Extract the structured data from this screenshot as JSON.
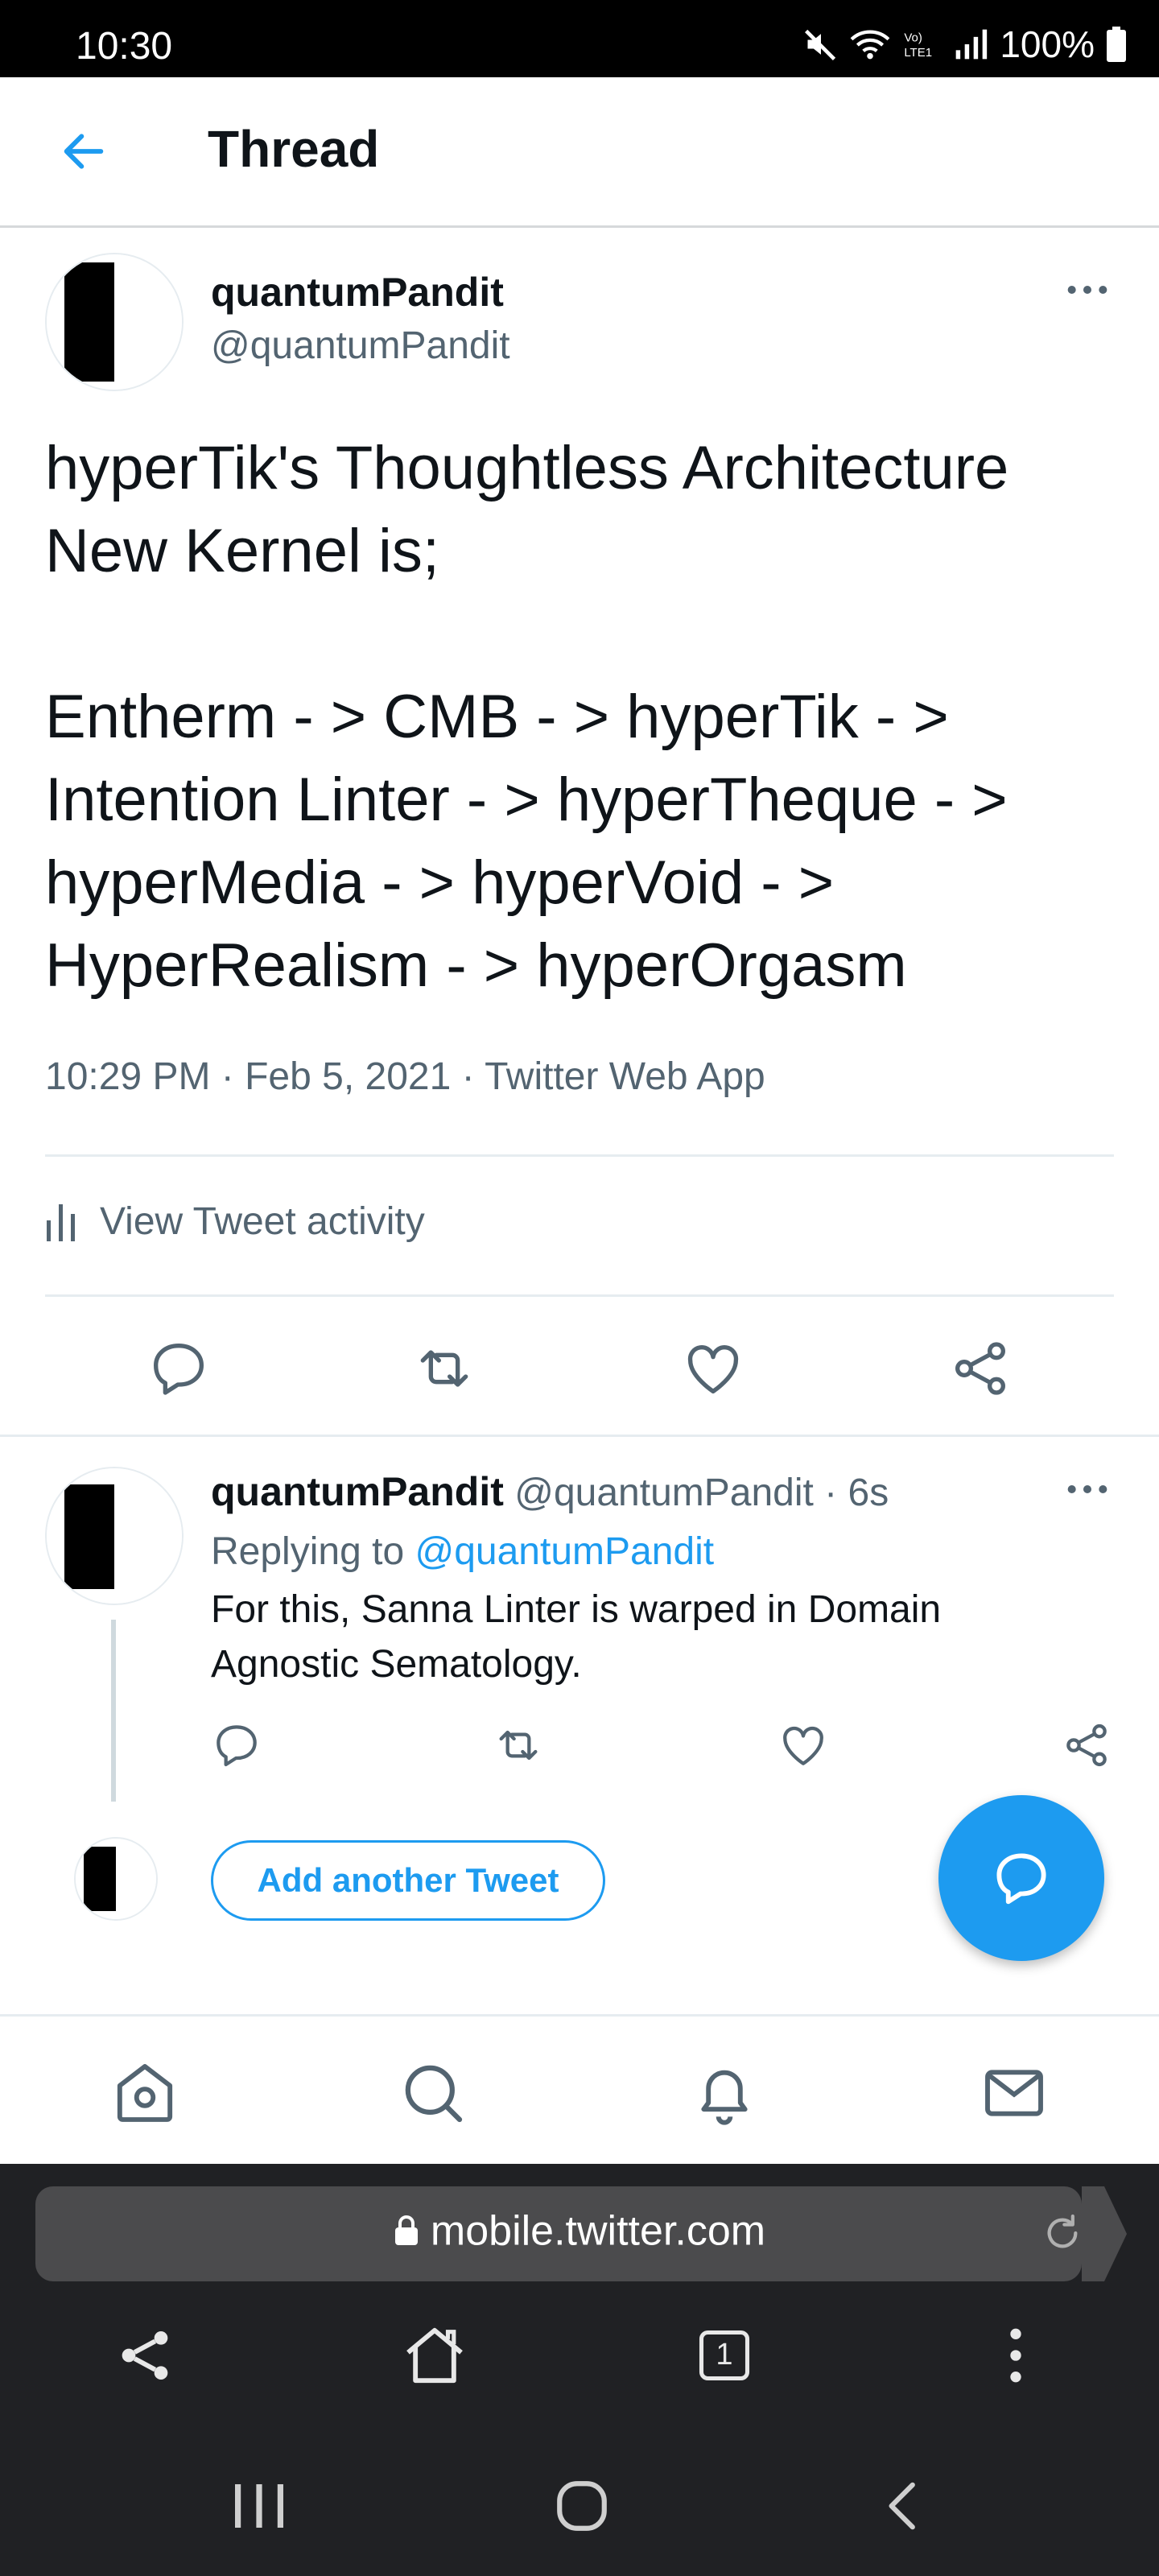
{
  "status_bar": {
    "time": "10:30",
    "battery": "100%"
  },
  "header": {
    "title": "Thread"
  },
  "main_tweet": {
    "author_name": "quantumPandit",
    "author_handle": "@quantumPandit",
    "text": "hyperTik's Thoughtless Architecture New Kernel is;\n\nEntherm - > CMB - > hyperTik - > Intention Linter - > hyperTheque - > hyperMedia - > hyperVoid - > HyperRealism - > hyperOrgasm",
    "time": "10:29 PM",
    "date": "Feb 5, 2021",
    "source": "Twitter Web App",
    "activity_label": "View Tweet activity"
  },
  "reply_tweet": {
    "author_name": "quantumPandit",
    "author_handle": "@quantumPandit",
    "age": "6s",
    "replying_prefix": "Replying to",
    "replying_handle": "@quantumPandit",
    "text": "For this, Sanna Linter is warped in Domain Agnostic Sematology."
  },
  "compose": {
    "add_label": "Add another Tweet"
  },
  "bottom_nav": {
    "items": [
      "home-icon",
      "search-icon",
      "notifications-icon",
      "messages-icon"
    ]
  },
  "browser": {
    "url": "mobile.twitter.com",
    "tab_count": "1"
  },
  "colors": {
    "accent": "#1d9bf0",
    "secondary_text": "#536471",
    "divider": "#e6ecf0"
  }
}
